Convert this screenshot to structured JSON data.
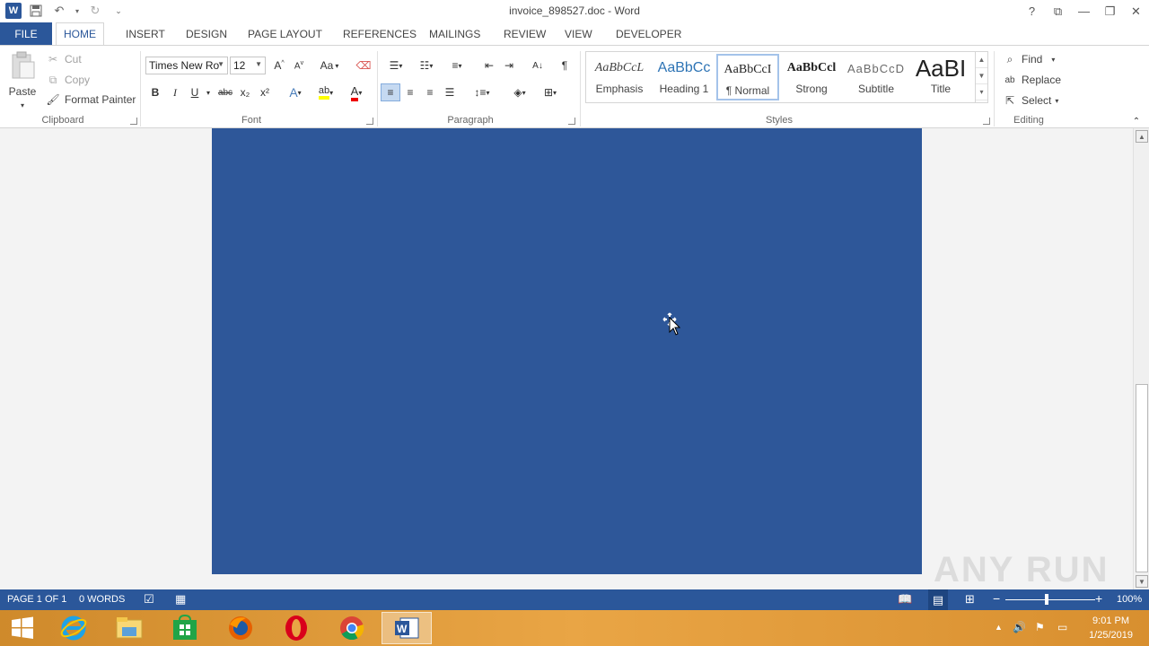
{
  "window": {
    "title": "invoice_898527.doc - Word",
    "controls": [
      "?",
      "⧉",
      "—",
      "❐",
      "✕"
    ]
  },
  "tabs": {
    "file": "FILE",
    "items": [
      "HOME",
      "INSERT",
      "DESIGN",
      "PAGE LAYOUT",
      "REFERENCES",
      "MAILINGS",
      "REVIEW",
      "VIEW",
      "DEVELOPER"
    ],
    "active": "HOME"
  },
  "clipboard": {
    "paste": "Paste",
    "cut": "Cut",
    "copy": "Copy",
    "format_painter": "Format Painter",
    "label": "Clipboard"
  },
  "font": {
    "family": "Times New Ro",
    "size": "12",
    "label": "Font",
    "bold": "B",
    "italic": "I",
    "underline": "U",
    "strike": "abc",
    "sub": "x₂",
    "sup": "x²",
    "case": "Aa"
  },
  "paragraph": {
    "label": "Paragraph"
  },
  "styles": {
    "label": "Styles",
    "items": [
      {
        "preview": "AaBbCcL",
        "name": "Emphasis"
      },
      {
        "preview": "AaBbCc",
        "name": "Heading 1"
      },
      {
        "preview": "AaBbCcI",
        "name": "¶ Normal"
      },
      {
        "preview": "AaBbCcl",
        "name": "Strong"
      },
      {
        "preview": "AaBbCcD",
        "name": "Subtitle"
      },
      {
        "preview": "AaBI",
        "name": "Title"
      }
    ]
  },
  "editing": {
    "label": "Editing",
    "find": "Find",
    "replace": "Replace",
    "select": "Select"
  },
  "statusbar": {
    "page": "PAGE 1 OF 1",
    "words": "0 WORDS",
    "zoom": "100%"
  },
  "taskbar": {
    "time": "9:01 PM",
    "date": "1/25/2019"
  },
  "watermark": "ANY RUN",
  "colors": {
    "accent": "#2b579a",
    "page_fill": "#2e5799",
    "taskbar": "#e9a545"
  }
}
